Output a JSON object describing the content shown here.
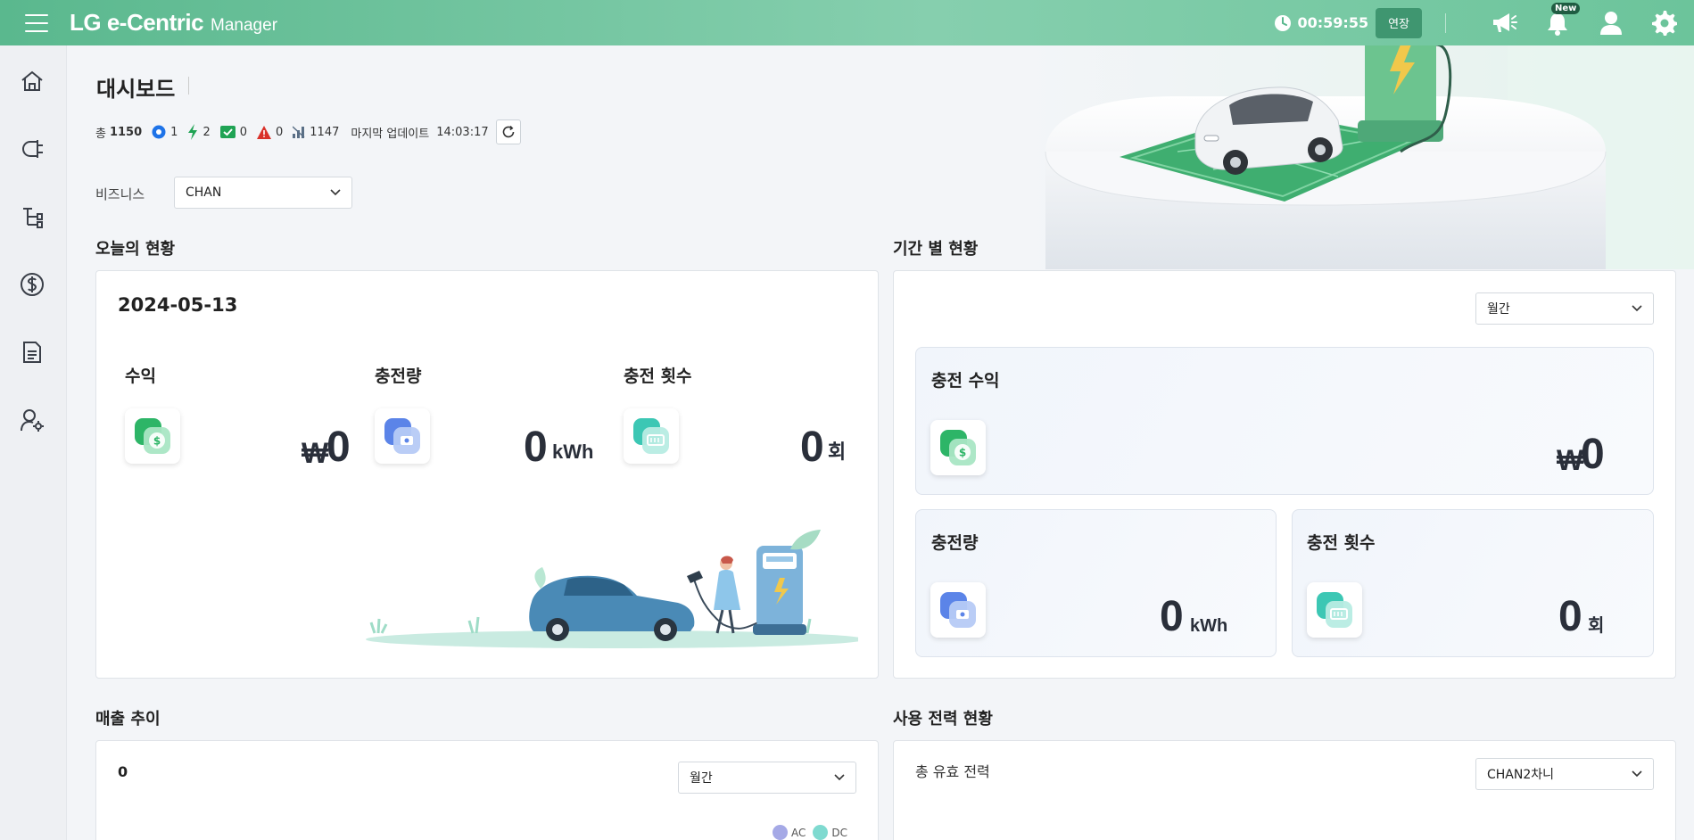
{
  "header": {
    "brand_main": "LG e-Centric",
    "brand_sub": "Manager",
    "timer": "00:59:55",
    "extend_label": "연장",
    "new_badge": "New"
  },
  "sidebar": {
    "items": [
      "home-icon",
      "plug-icon",
      "hierarchy-icon",
      "dollar-icon",
      "document-icon",
      "user-settings-icon"
    ]
  },
  "page": {
    "title": "대시보드",
    "stats": {
      "total_label": "총",
      "total": "1150",
      "available": "1",
      "charging": "2",
      "completed": "0",
      "error": "0",
      "offline": "1147",
      "update_label": "마지막 업데이트",
      "update_time": "14:03:17"
    },
    "business_label": "비즈니스",
    "business_value": "CHAN"
  },
  "today": {
    "section_title": "오늘의 현황",
    "date": "2024-05-13",
    "revenue_label": "수익",
    "revenue_currency": "₩",
    "revenue_value": "0",
    "energy_label": "충전량",
    "energy_value": "0",
    "energy_unit": "kWh",
    "count_label": "충전 횟수",
    "count_value": "0",
    "count_unit": "회"
  },
  "period": {
    "section_title": "기간 별 현황",
    "period_select": "월간",
    "revenue_label": "충전 수익",
    "revenue_currency": "₩",
    "revenue_value": "0",
    "energy_label": "충전량",
    "energy_value": "0",
    "energy_unit": "kWh",
    "count_label": "충전 횟수",
    "count_value": "0",
    "count_unit": "회"
  },
  "sales": {
    "section_title": "매출 추이",
    "total_value": "0",
    "period_select": "월간",
    "legend": [
      "AC",
      "DC"
    ]
  },
  "power": {
    "section_title": "사용 전력 현황",
    "subtitle": "총 유효 전력",
    "site_select": "CHAN2차니"
  },
  "colors": {
    "header_green": "#5ab88e",
    "extend_button": "#3f9670",
    "legend_ac": "#a5a9e6",
    "legend_dc": "#7fdad0"
  }
}
